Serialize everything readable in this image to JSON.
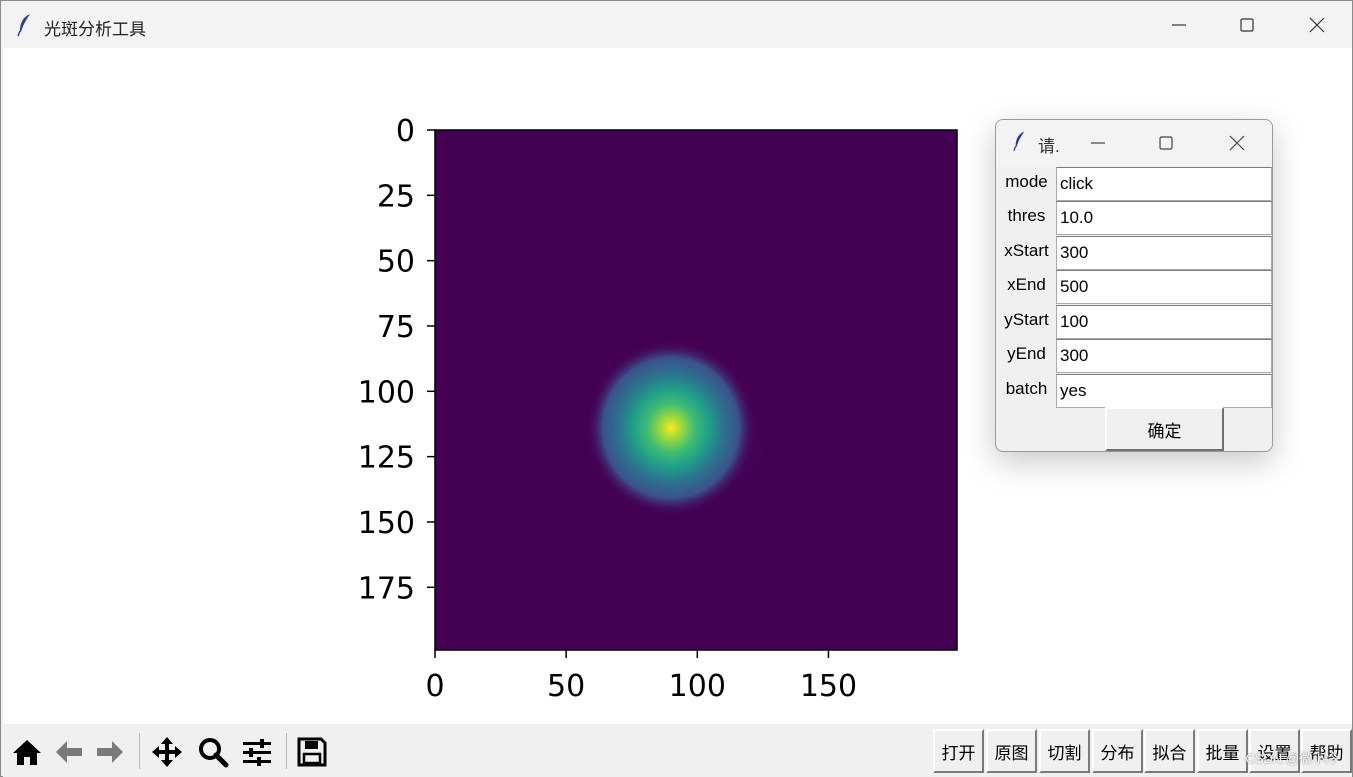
{
  "window": {
    "title": "光斑分析工具"
  },
  "dialog": {
    "title": "请.",
    "fields": [
      {
        "label": "mode",
        "value": "click"
      },
      {
        "label": "thres",
        "value": "10.0"
      },
      {
        "label": "xStart",
        "value": "300"
      },
      {
        "label": "xEnd",
        "value": "500"
      },
      {
        "label": "yStart",
        "value": "100"
      },
      {
        "label": "yEnd",
        "value": "300"
      },
      {
        "label": "batch",
        "value": "yes"
      }
    ],
    "ok_label": "确定"
  },
  "toolbar": {
    "nav_icons": [
      "home-icon",
      "back-arrow-icon",
      "forward-arrow-icon",
      "pan-move-icon",
      "zoom-magnifier-icon",
      "configure-subplots-icon",
      "save-disk-icon"
    ],
    "buttons": [
      "打开",
      "原图",
      "切割",
      "分布",
      "拟合",
      "批量",
      "设置",
      "帮助"
    ]
  },
  "watermark": "CSDN @微小冷",
  "chart_data": {
    "type": "heatmap",
    "colormap": "viridis",
    "background_color": "#440154",
    "x_ticks": [
      "0",
      "50",
      "100",
      "150"
    ],
    "y_ticks": [
      "0",
      "25",
      "50",
      "75",
      "100",
      "125",
      "150",
      "175"
    ],
    "xlim": [
      0,
      199
    ],
    "ylim": [
      199,
      0
    ],
    "spot": {
      "center_x": 90,
      "center_y": 114,
      "sigma": 14,
      "peak_color": "#fde725"
    }
  }
}
